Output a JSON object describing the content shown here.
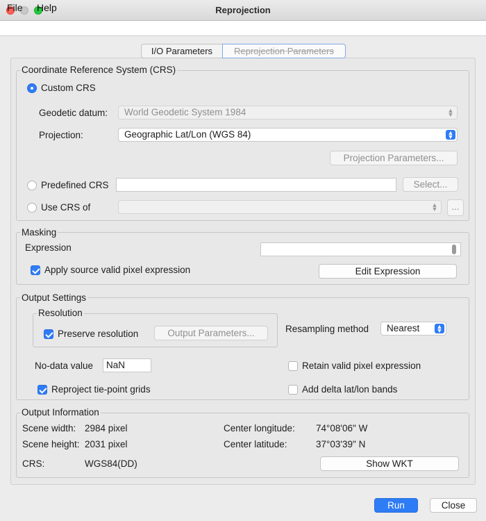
{
  "window": {
    "title": "Reprojection"
  },
  "menu": {
    "file": "File",
    "help": "Help"
  },
  "tabs": {
    "io": "I/O Parameters",
    "reprojection": "Reprojection Parameters"
  },
  "crs": {
    "group_title": "Coordinate Reference System (CRS)",
    "custom_label": "Custom CRS",
    "geodetic_datum_label": "Geodetic datum:",
    "geodetic_datum_value": "World Geodetic System 1984",
    "projection_label": "Projection:",
    "projection_value": "Geographic Lat/Lon (WGS 84)",
    "projection_params_button": "Projection Parameters...",
    "predefined_label": "Predefined CRS",
    "predefined_value": "",
    "select_button": "Select...",
    "use_crs_of_label": "Use CRS of",
    "use_crs_of_value": "",
    "browse_button": "..."
  },
  "masking": {
    "group_title": "Masking",
    "expression_label": "Expression",
    "expression_value": "",
    "apply_source_label": "Apply source valid pixel expression",
    "edit_expression_button": "Edit Expression"
  },
  "output_settings": {
    "group_title": "Output Settings",
    "resolution_title": "Resolution",
    "preserve_resolution_label": "Preserve resolution",
    "output_params_button": "Output Parameters...",
    "resampling_label": "Resampling method",
    "resampling_value": "Nearest",
    "nodata_label": "No-data value",
    "nodata_value": "NaN",
    "retain_valid_label": "Retain valid pixel expression",
    "reproject_tiepoint_label": "Reproject tie-point grids",
    "add_delta_label": "Add delta lat/lon bands"
  },
  "output_info": {
    "group_title": "Output Information",
    "scene_width_label": "Scene width:",
    "scene_width_value": "2984 pixel",
    "scene_height_label": "Scene height:",
    "scene_height_value": "2031 pixel",
    "crs_label": "CRS:",
    "crs_value": "WGS84(DD)",
    "center_lon_label": "Center longitude:",
    "center_lon_value": "74°08'06\" W",
    "center_lat_label": "Center latitude:",
    "center_lat_value": "37°03'39\" N",
    "show_wkt_button": "Show WKT"
  },
  "footer": {
    "run_button": "Run",
    "close_button": "Close"
  },
  "colors": {
    "accent": "#2e7cf6",
    "close_dot": "#ff5f57",
    "max_dot": "#28c840"
  }
}
